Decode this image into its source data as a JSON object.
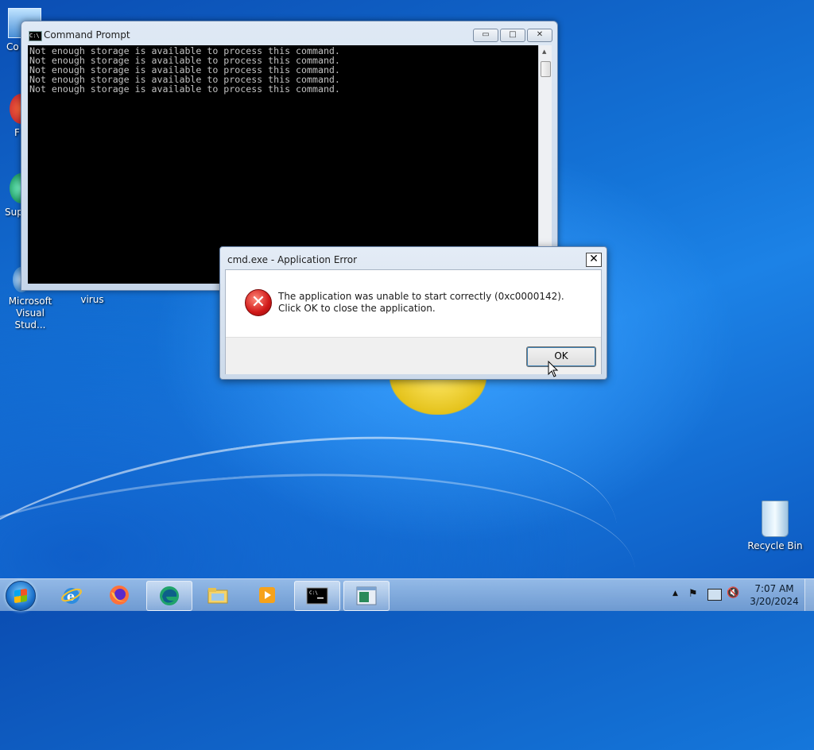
{
  "desktop": {
    "icons": [
      {
        "label": "Co"
      },
      {
        "label": "F"
      },
      {
        "label": "Sup"
      },
      {
        "label": "Microsoft Visual Stud..."
      },
      {
        "label": "virus"
      },
      {
        "label": "Recycle Bin"
      }
    ]
  },
  "cmd_window": {
    "title": "Command Prompt",
    "icon_text": "C:\\",
    "minimize_glyph": "▭",
    "maximize_glyph": "□",
    "close_glyph": "✕",
    "lines": [
      "Not enough storage is available to process this command.",
      "Not enough storage is available to process this command.",
      "Not enough storage is available to process this command.",
      "Not enough storage is available to process this command.",
      "Not enough storage is available to process this command."
    ]
  },
  "error_dialog": {
    "title": "cmd.exe - Application Error",
    "close_glyph": "✕",
    "icon_glyph": "✕",
    "message": "The application was unable to start correctly (0xc0000142). Click OK to close the application.",
    "ok_label": "OK"
  },
  "taskbar": {
    "items": [
      "start-orb",
      "internet-explorer-icon",
      "firefox-icon",
      "edge-icon",
      "file-explorer-icon",
      "media-player-icon",
      "command-prompt-icon",
      "application-icon"
    ],
    "active_items": [
      "edge",
      "command-prompt",
      "application"
    ],
    "tray": {
      "time": "7:07 AM",
      "date": "3/20/2024",
      "icons": [
        "show-hidden-icons",
        "action-center-flag-icon",
        "network-icon",
        "volume-muted-icon"
      ]
    }
  }
}
